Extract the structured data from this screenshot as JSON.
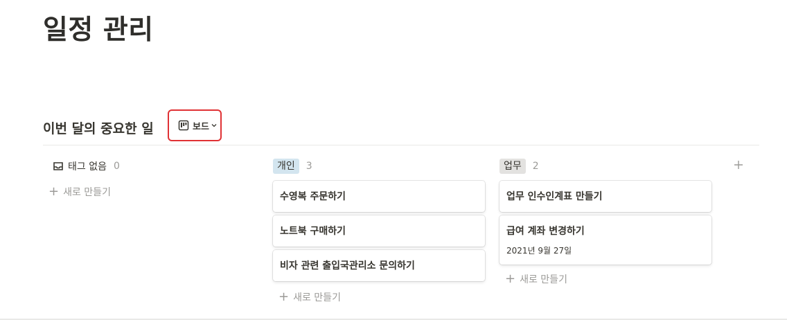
{
  "page": {
    "title": "일정 관리"
  },
  "database": {
    "title": "이번 달의 중요한 일",
    "view_label": "보드"
  },
  "board": {
    "groups": [
      {
        "name": "태그 없음",
        "count": "0",
        "new_label": "새로 만들기",
        "cards": []
      },
      {
        "name": "개인",
        "count": "3",
        "tag_color": "#d3e5ef",
        "new_label": "새로 만들기",
        "cards": [
          {
            "title": "수영복 주문하기"
          },
          {
            "title": "노트북 구매하기"
          },
          {
            "title": "비자 관련 출입국관리소 문의하기"
          }
        ]
      },
      {
        "name": "업무",
        "count": "2",
        "tag_color": "#e3e2e0",
        "new_label": "새로 만들기",
        "cards": [
          {
            "title": "업무 인수인계표 만들기"
          },
          {
            "title": "급여 계좌 변경하기",
            "date": "2021년 9월 27일"
          }
        ]
      }
    ],
    "add_group_icon": "plus-icon"
  },
  "colors": {
    "highlight_border": "#e03134",
    "text": "#37352f",
    "muted": "#9b9a97"
  }
}
